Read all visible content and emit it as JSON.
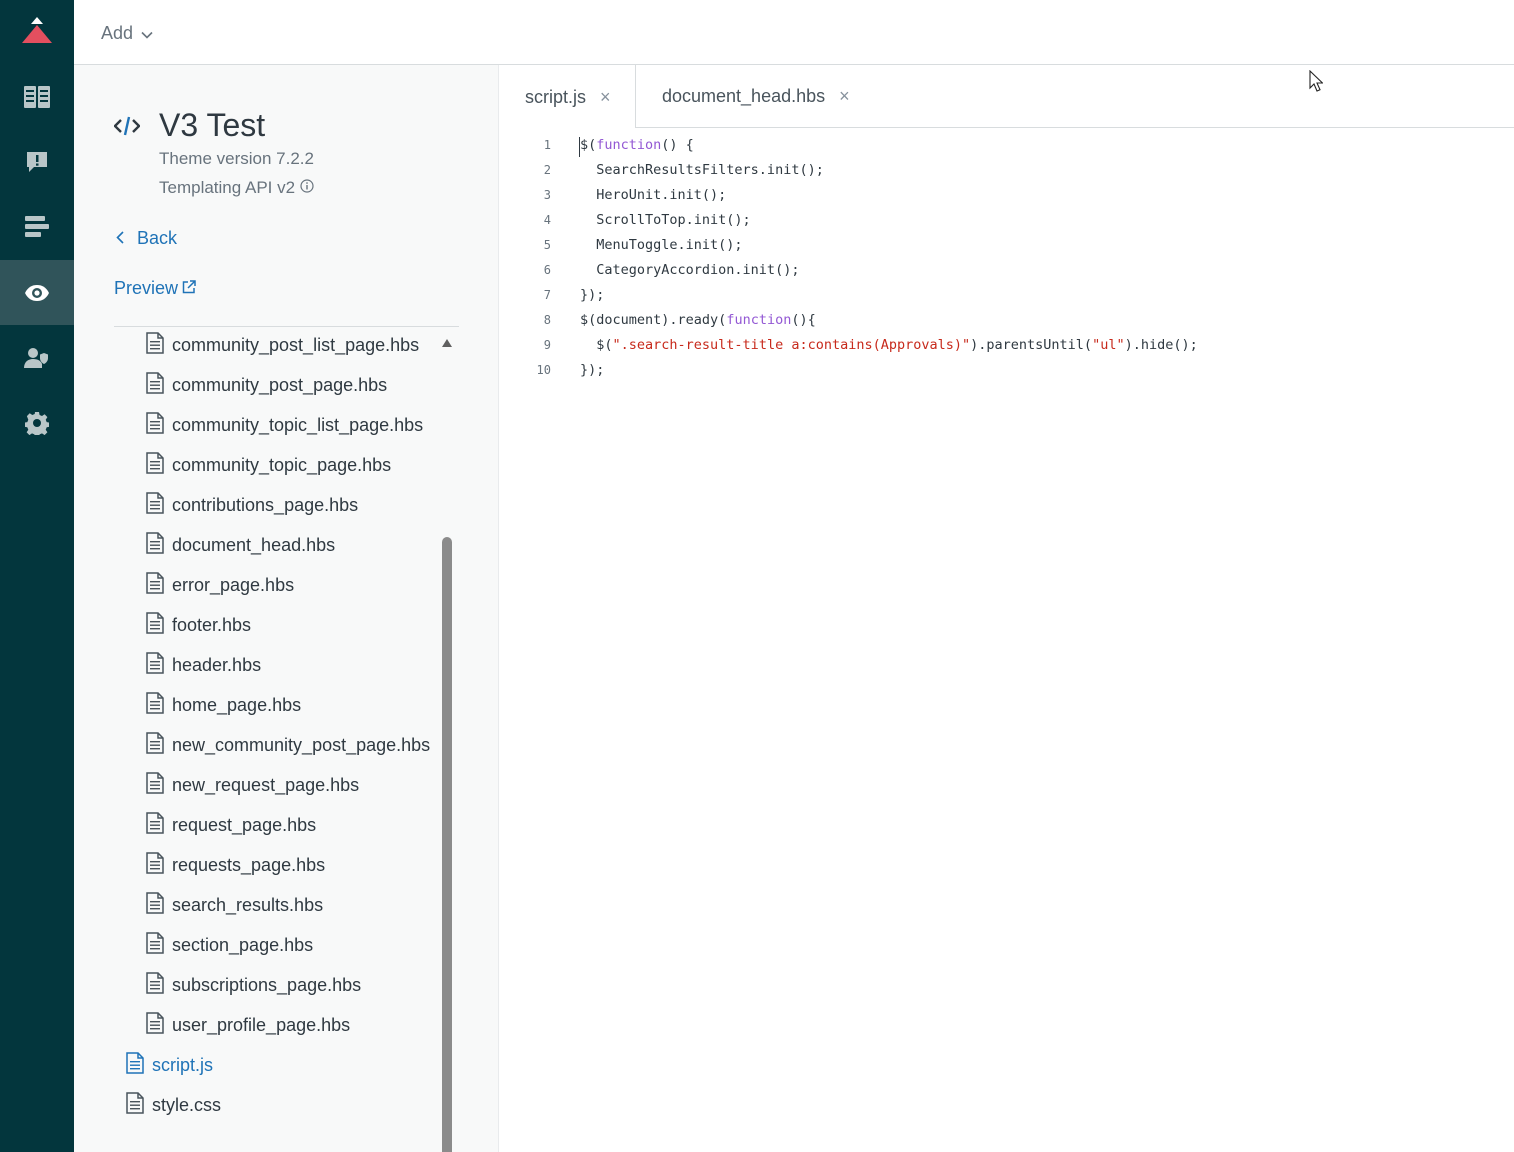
{
  "rail": {
    "items": [
      {
        "name": "guide-icon"
      },
      {
        "name": "alert-icon"
      },
      {
        "name": "arrange-icon"
      },
      {
        "name": "eye-icon",
        "active": true
      },
      {
        "name": "user-permissions-icon"
      },
      {
        "name": "gear-icon"
      }
    ],
    "colors": {
      "bg": "#03363d",
      "active": "#30545a",
      "logo_accent": "#e34f5f"
    }
  },
  "topbar": {
    "add_label": "Add"
  },
  "theme": {
    "title": "V3 Test",
    "version": "Theme version 7.2.2",
    "api": "Templating API v2"
  },
  "links": {
    "back": "Back",
    "preview": "Preview"
  },
  "files": [
    {
      "label": "community_post_list_page.hbs",
      "indent": 1
    },
    {
      "label": "community_post_page.hbs",
      "indent": 1
    },
    {
      "label": "community_topic_list_page.hbs",
      "indent": 1
    },
    {
      "label": "community_topic_page.hbs",
      "indent": 1
    },
    {
      "label": "contributions_page.hbs",
      "indent": 1
    },
    {
      "label": "document_head.hbs",
      "indent": 1
    },
    {
      "label": "error_page.hbs",
      "indent": 1
    },
    {
      "label": "footer.hbs",
      "indent": 1
    },
    {
      "label": "header.hbs",
      "indent": 1
    },
    {
      "label": "home_page.hbs",
      "indent": 1
    },
    {
      "label": "new_community_post_page.hbs",
      "indent": 1
    },
    {
      "label": "new_request_page.hbs",
      "indent": 1
    },
    {
      "label": "request_page.hbs",
      "indent": 1
    },
    {
      "label": "requests_page.hbs",
      "indent": 1
    },
    {
      "label": "search_results.hbs",
      "indent": 1
    },
    {
      "label": "section_page.hbs",
      "indent": 1
    },
    {
      "label": "subscriptions_page.hbs",
      "indent": 1
    },
    {
      "label": "user_profile_page.hbs",
      "indent": 1
    },
    {
      "label": "script.js",
      "indent": 0,
      "active": true
    },
    {
      "label": "style.css",
      "indent": 0
    }
  ],
  "tabs": [
    {
      "label": "script.js",
      "close": "×",
      "active": true
    },
    {
      "label": "document_head.hbs",
      "close": "×",
      "active": false
    }
  ],
  "code_lines": [
    {
      "num": "1",
      "tokens": [
        {
          "t": "$(",
          "c": ""
        },
        {
          "t": "function",
          "c": "kw"
        },
        {
          "t": "() {",
          "c": ""
        }
      ]
    },
    {
      "num": "2",
      "tokens": [
        {
          "t": "  SearchResultsFilters.init();",
          "c": ""
        }
      ]
    },
    {
      "num": "3",
      "tokens": [
        {
          "t": "  HeroUnit.init();",
          "c": ""
        }
      ]
    },
    {
      "num": "4",
      "tokens": [
        {
          "t": "  ScrollToTop.init();",
          "c": ""
        }
      ]
    },
    {
      "num": "5",
      "tokens": [
        {
          "t": "  MenuToggle.init();",
          "c": ""
        }
      ]
    },
    {
      "num": "6",
      "tokens": [
        {
          "t": "  CategoryAccordion.init();",
          "c": ""
        }
      ]
    },
    {
      "num": "7",
      "tokens": [
        {
          "t": "});",
          "c": ""
        }
      ]
    },
    {
      "num": "8",
      "tokens": [
        {
          "t": "$(document).ready(",
          "c": ""
        },
        {
          "t": "function",
          "c": "kw"
        },
        {
          "t": "(){",
          "c": ""
        }
      ]
    },
    {
      "num": "9",
      "tokens": [
        {
          "t": "  $(",
          "c": ""
        },
        {
          "t": "\".search-result-title a:contains(Approvals)\"",
          "c": "str"
        },
        {
          "t": ").parentsUntil(",
          "c": ""
        },
        {
          "t": "\"ul\"",
          "c": "str"
        },
        {
          "t": ").hide();",
          "c": ""
        }
      ]
    },
    {
      "num": "10",
      "tokens": [
        {
          "t": "});",
          "c": ""
        }
      ]
    }
  ]
}
